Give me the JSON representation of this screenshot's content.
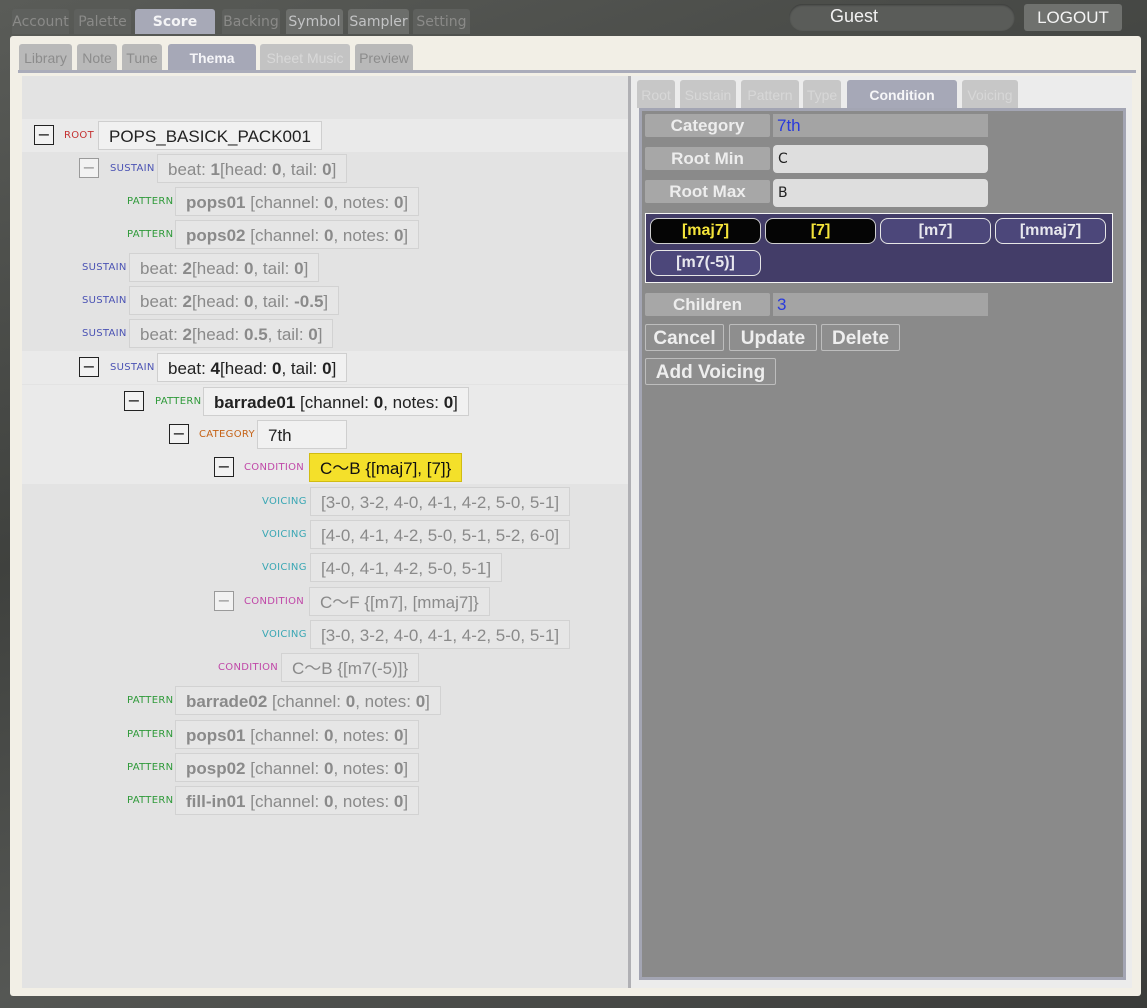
{
  "top_tabs": [
    "Account",
    "Palette",
    "Score",
    "Backing",
    "Symbol",
    "Sampler",
    "Setting"
  ],
  "user": {
    "name": "Guest",
    "logout_label": "LOGOUT"
  },
  "sub_tabs": [
    "Library",
    "Note",
    "Tune",
    "Thema",
    "Sheet Music",
    "Preview"
  ],
  "tree": {
    "tags": {
      "root": "ROOT",
      "sustain": "SUSTAIN",
      "pattern": "PATTERN",
      "category": "CATEGORY",
      "condition": "CONDITION",
      "voicing": "VOICING"
    },
    "toggle_symbol": "−",
    "root_name": "POPS_BASICK_PACK001",
    "sustain1": {
      "a": "beat: ",
      "b": "1",
      "c": "[head: ",
      "d": "0",
      "e": ", tail: ",
      "f": "0",
      "g": "]"
    },
    "pattern_pops01": {
      "name": "pops01",
      "a": " [channel: ",
      "b": "0",
      "c": ", notes: ",
      "d": "0",
      "e": "]"
    },
    "pattern_pops02": {
      "name": "pops02",
      "a": " [channel: ",
      "b": "0",
      "c": ", notes: ",
      "d": "0",
      "e": "]"
    },
    "sustain2": {
      "a": "beat: ",
      "b": "2",
      "c": "[head: ",
      "d": "0",
      "e": ", tail: ",
      "f": "0",
      "g": "]"
    },
    "sustain3": {
      "a": "beat: ",
      "b": "2",
      "c": "[head: ",
      "d": "0",
      "e": ", tail: ",
      "f": "-0.5",
      "g": "]"
    },
    "sustain4": {
      "a": "beat: ",
      "b": "2",
      "c": "[head: ",
      "d": "0.5",
      "e": ", tail: ",
      "f": "0",
      "g": "]"
    },
    "sustain5": {
      "a": "beat: ",
      "b": "4",
      "c": "[head: ",
      "d": "0",
      "e": ", tail: ",
      "f": "0",
      "g": "]"
    },
    "pattern_barrade01": {
      "name": "barrade01",
      "a": " [channel: ",
      "b": "0",
      "c": ", notes: ",
      "d": "0",
      "e": "]"
    },
    "category": "7th",
    "condition1": "C～B {[maj7], [7]}",
    "voicing1": "[3-0, 3-2, 4-0, 4-1, 4-2, 5-0, 5-1]",
    "voicing2": "[4-0, 4-1, 4-2, 5-0, 5-1, 5-2, 6-0]",
    "voicing3": "[4-0, 4-1, 4-2, 5-0, 5-1]",
    "condition2": "C～F {[m7], [mmaj7]}",
    "voicing4": "[3-0, 3-2, 4-0, 4-1, 4-2, 5-0, 5-1]",
    "condition3": "C～B {[m7(-5)]}",
    "pattern_barrade02": {
      "name": "barrade02",
      "a": " [channel: ",
      "b": "0",
      "c": ", notes: ",
      "d": "0",
      "e": "]"
    },
    "pattern_pops01b": {
      "name": "pops01",
      "a": " [channel: ",
      "b": "0",
      "c": ", notes: ",
      "d": "0",
      "e": "]"
    },
    "pattern_posp02": {
      "name": "posp02",
      "a": " [channel: ",
      "b": "0",
      "c": ", notes: ",
      "d": "0",
      "e": "]"
    },
    "pattern_fillin01": {
      "name": "fill-in01",
      "a": " [channel: ",
      "b": "0",
      "c": ", notes: ",
      "d": "0",
      "e": "]"
    }
  },
  "detail": {
    "tabs": [
      "Root",
      "Sustain",
      "Pattern",
      "Type",
      "Condition",
      "Voicing"
    ],
    "category_label": "Category",
    "category_value": "7th",
    "root_min_label": "Root Min",
    "root_min_value": "C",
    "root_max_label": "Root Max",
    "root_max_value": "B",
    "chords": [
      {
        "label": "[maj7]",
        "selected": true
      },
      {
        "label": "[7]",
        "selected": true
      },
      {
        "label": "[m7]",
        "selected": false
      },
      {
        "label": "[mmaj7]",
        "selected": false
      },
      {
        "label": "[m7(-5)]",
        "selected": false
      }
    ],
    "children_label": "Children",
    "children_value": "3",
    "cancel_label": "Cancel",
    "update_label": "Update",
    "delete_label": "Delete",
    "add_voicing_label": "Add Voicing"
  }
}
